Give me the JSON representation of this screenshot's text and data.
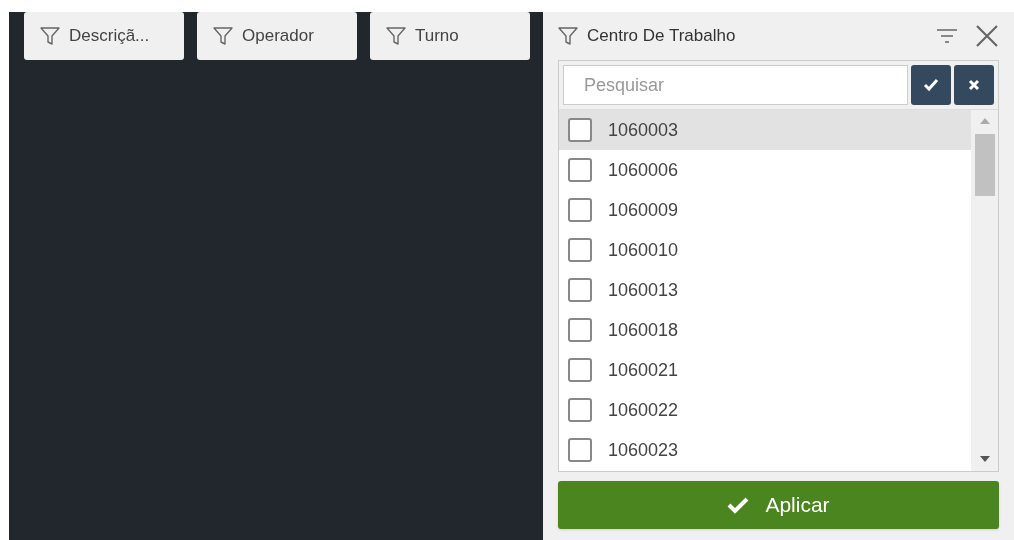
{
  "filter_chips": [
    {
      "label": "Descriçã..."
    },
    {
      "label": "Operador"
    },
    {
      "label": "Turno"
    }
  ],
  "panel": {
    "title": "Centro De Trabalho",
    "search": {
      "placeholder": "Pesquisar"
    },
    "items": [
      {
        "label": "1060003",
        "checked": false,
        "highlighted": true
      },
      {
        "label": "1060006",
        "checked": false,
        "highlighted": false
      },
      {
        "label": "1060009",
        "checked": false,
        "highlighted": false
      },
      {
        "label": "1060010",
        "checked": false,
        "highlighted": false
      },
      {
        "label": "1060013",
        "checked": false,
        "highlighted": false
      },
      {
        "label": "1060018",
        "checked": false,
        "highlighted": false
      },
      {
        "label": "1060021",
        "checked": false,
        "highlighted": false
      },
      {
        "label": "1060022",
        "checked": false,
        "highlighted": false
      },
      {
        "label": "1060023",
        "checked": false,
        "highlighted": false
      }
    ],
    "apply_button": "Aplicar"
  }
}
